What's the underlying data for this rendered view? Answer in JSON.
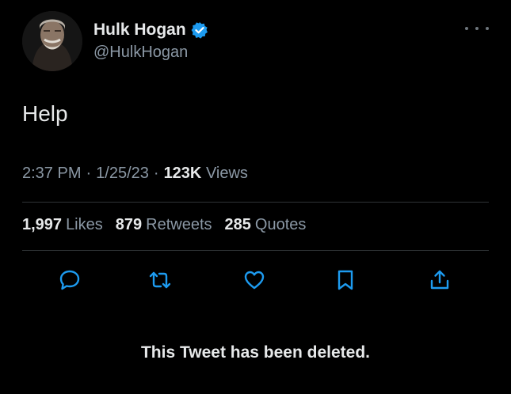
{
  "author": {
    "display_name": "Hulk Hogan",
    "handle": "@HulkHogan",
    "verified_icon": "verified-badge-icon",
    "verified_color": "#1d9bf0"
  },
  "tweet": {
    "text": "Help",
    "time": "2:37 PM",
    "date": "1/25/23",
    "views_count": "123K",
    "views_label": "Views",
    "separator": "·"
  },
  "stats": {
    "likes_count": "1,997",
    "likes_label": "Likes",
    "retweets_count": "879",
    "retweets_label": "Retweets",
    "quotes_count": "285",
    "quotes_label": "Quotes"
  },
  "actions": [
    "reply-icon",
    "retweet-icon",
    "like-icon",
    "bookmark-icon",
    "share-icon"
  ],
  "notice": "This Tweet has been deleted.",
  "colors": {
    "background": "#000000",
    "primary_text": "#e7e9ea",
    "secondary_text": "#8b98a5",
    "action_icon": "#1d9bf0",
    "divider": "#2f3336"
  }
}
